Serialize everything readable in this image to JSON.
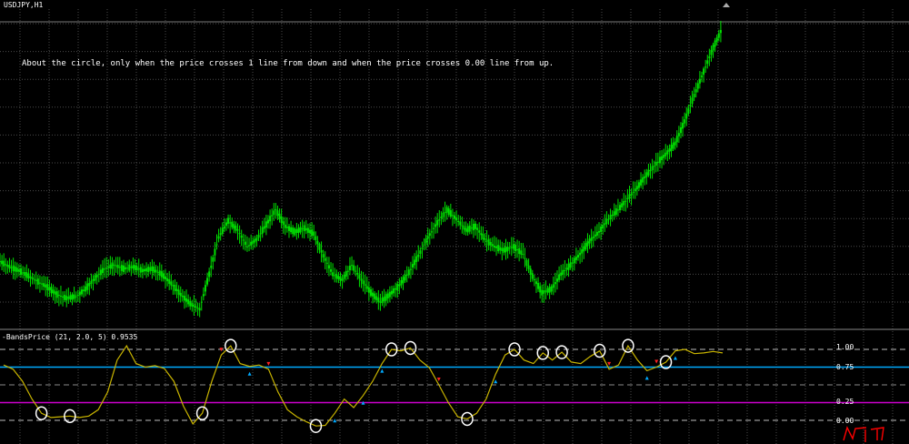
{
  "window": {
    "symbol_label": "USDJPY,H1"
  },
  "annotation": {
    "text": "About the circle, only when the price crosses 1 line from down and when the price crosses 0.00 line from up."
  },
  "indicator": {
    "label": "-BandsPrice (21, 2.0, 5) 0.9535"
  },
  "colors": {
    "background": "#000000",
    "grid": "#4a4a4a",
    "candles": "#00e000",
    "oscillator": "#c8b400",
    "line_075": "#00aaff",
    "line_025": "#cc00cc",
    "circle": "#ffffff",
    "arrow_up": "#00aaff",
    "arrow_down": "#ff2020",
    "scribble": "#ff0000"
  },
  "chart_data": [
    {
      "type": "line",
      "title": "USDJPY,H1",
      "series": [
        {
          "values": [
            83.2,
            82.9,
            82.7,
            82.4,
            82.1,
            81.8,
            81.4,
            81.2,
            81.3,
            81.7,
            82.3,
            82.8,
            83.0,
            82.8,
            82.9,
            82.7,
            82.8,
            82.5,
            82.0,
            81.4,
            80.9,
            80.6,
            82.5,
            84.5,
            85.4,
            84.9,
            84.0,
            84.4,
            85.2,
            86.0,
            85.1,
            84.8,
            85.0,
            84.7,
            83.5,
            82.5,
            82.2,
            83.0,
            82.2,
            81.5,
            81.0,
            81.4,
            81.9,
            82.6,
            83.5,
            84.5,
            85.3,
            86.0,
            85.5,
            84.9,
            85.1,
            84.4,
            84.0,
            83.8,
            84.0,
            83.6,
            82.4,
            81.5,
            81.7,
            82.5,
            83.0,
            83.6,
            84.3,
            84.8,
            85.5,
            86.0,
            86.6,
            87.2,
            87.9,
            88.5,
            89.0,
            89.6,
            90.8,
            92.2,
            93.5,
            94.8,
            95.9
          ]
        }
      ]
    },
    {
      "type": "line",
      "title": "-BandsPrice (21, 2.0, 5) 0.9535",
      "ylim": [
        -0.1,
        1.1
      ],
      "levels": [
        {
          "value": 1.0,
          "label": "1.00"
        },
        {
          "value": 0.75,
          "label": "0.75"
        },
        {
          "value": 0.25,
          "label": "0.25"
        },
        {
          "value": 0.0,
          "label": "0.00"
        }
      ],
      "series": [
        {
          "values": [
            0.78,
            0.72,
            0.55,
            0.3,
            0.1,
            0.04,
            0.05,
            0.06,
            0.04,
            0.06,
            0.15,
            0.4,
            0.85,
            1.05,
            0.8,
            0.75,
            0.77,
            0.73,
            0.55,
            0.2,
            -0.05,
            0.1,
            0.55,
            0.92,
            1.05,
            0.8,
            0.76,
            0.78,
            0.72,
            0.4,
            0.15,
            0.05,
            -0.02,
            -0.08,
            -0.07,
            0.1,
            0.3,
            0.18,
            0.35,
            0.55,
            0.8,
            1.0,
            0.98,
            1.02,
            0.85,
            0.74,
            0.5,
            0.25,
            0.05,
            0.02,
            0.1,
            0.3,
            0.65,
            0.92,
            1.0,
            0.85,
            0.8,
            0.95,
            0.85,
            0.96,
            0.82,
            0.8,
            0.9,
            0.98,
            0.72,
            0.78,
            1.05,
            0.85,
            0.7,
            0.75,
            0.82,
            0.98,
            1.0,
            0.94,
            0.95,
            0.97,
            0.95
          ]
        }
      ],
      "circles_at_index": [
        4,
        7,
        21,
        24,
        33,
        41,
        43,
        49,
        54,
        57,
        59,
        63,
        66,
        70
      ],
      "arrows_up_at_index": [
        26,
        35,
        38,
        40,
        52,
        68,
        71
      ],
      "arrows_down_at_index": [
        23,
        28,
        46,
        64,
        69
      ]
    }
  ]
}
